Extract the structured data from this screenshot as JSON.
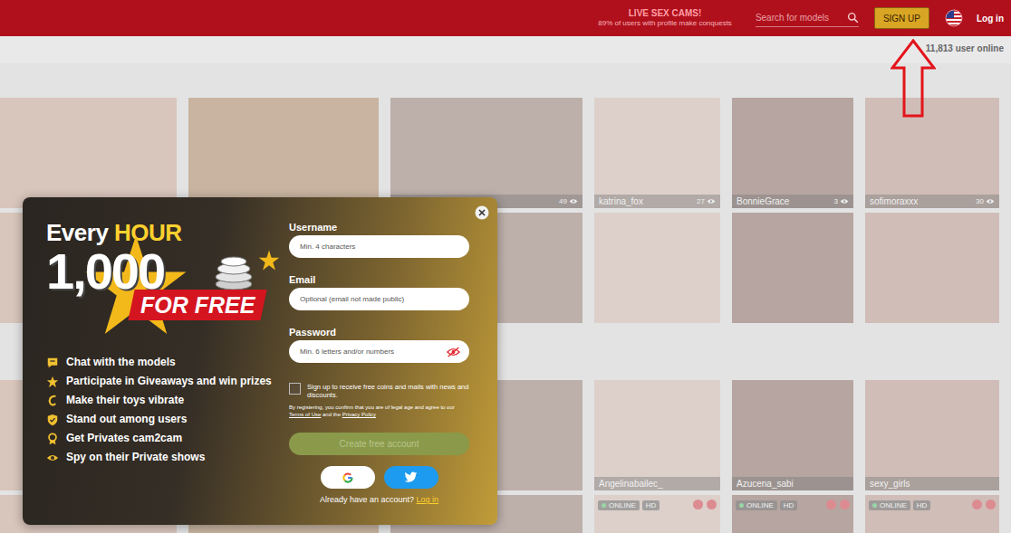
{
  "header": {
    "title": "LIVE SEX CAMS!",
    "subtitle": "89% of users with profile make conquests",
    "search": {
      "placeholder": "Search for models"
    },
    "signup": "SIGN UP",
    "login": "Log in"
  },
  "online_count": "11,813 user online",
  "sections": [
    {
      "tiles": [
        {},
        {},
        {
          "viewers": "49"
        },
        {
          "name": "katrina_fox",
          "viewers": "27"
        },
        {
          "name": "BonnieGrace",
          "viewers": "3"
        },
        {
          "name": "sofimoraxxx",
          "viewers": "30"
        },
        {},
        {},
        {},
        {},
        {},
        {}
      ]
    },
    {
      "tiles": [
        {},
        {},
        {},
        {
          "name": "Angelinabailec_"
        },
        {
          "name": "Azucena_sabi"
        },
        {
          "name": "sexy_girls"
        },
        {},
        {},
        {},
        {
          "badges": [
            "ONLINE",
            "HD"
          ]
        },
        {
          "badges": [
            "ONLINE",
            "HD"
          ]
        },
        {
          "badges": [
            "ONLINE",
            "HD"
          ]
        }
      ]
    }
  ],
  "modal": {
    "promo": {
      "every": "Every",
      "hour": "HOUR",
      "amount": "1,000",
      "for_free": "FOR FREE"
    },
    "features": [
      "Chat with the models",
      "Participate in Giveaways and win prizes",
      "Make their toys vibrate",
      "Stand out among users",
      "Get Privates cam2cam",
      "Spy on their Private shows"
    ],
    "form": {
      "fields": [
        {
          "label": "Username",
          "placeholder": "Min. 4 characters",
          "kind": "text"
        },
        {
          "label": "Email",
          "placeholder": "Optional (email not made public)",
          "kind": "text"
        },
        {
          "label": "Password",
          "placeholder": "Min. 6 letters and/or numbers",
          "kind": "password"
        }
      ],
      "newsletter": {
        "label": "Sign up to receive free coins and mails with news and discounts.",
        "checked": false
      },
      "legal": {
        "before": "By registering, you confirm that you are of legal age and agree to our",
        "terms": "Terms of Use",
        "middle": "and the",
        "privacy": "Privacy Policy"
      },
      "submit": {
        "label": "Create free account",
        "disabled": true
      },
      "social": [
        {
          "kind": "google"
        },
        {
          "kind": "twitter"
        }
      ],
      "already": {
        "text": "Already have an account?",
        "link": "Log in"
      }
    }
  }
}
